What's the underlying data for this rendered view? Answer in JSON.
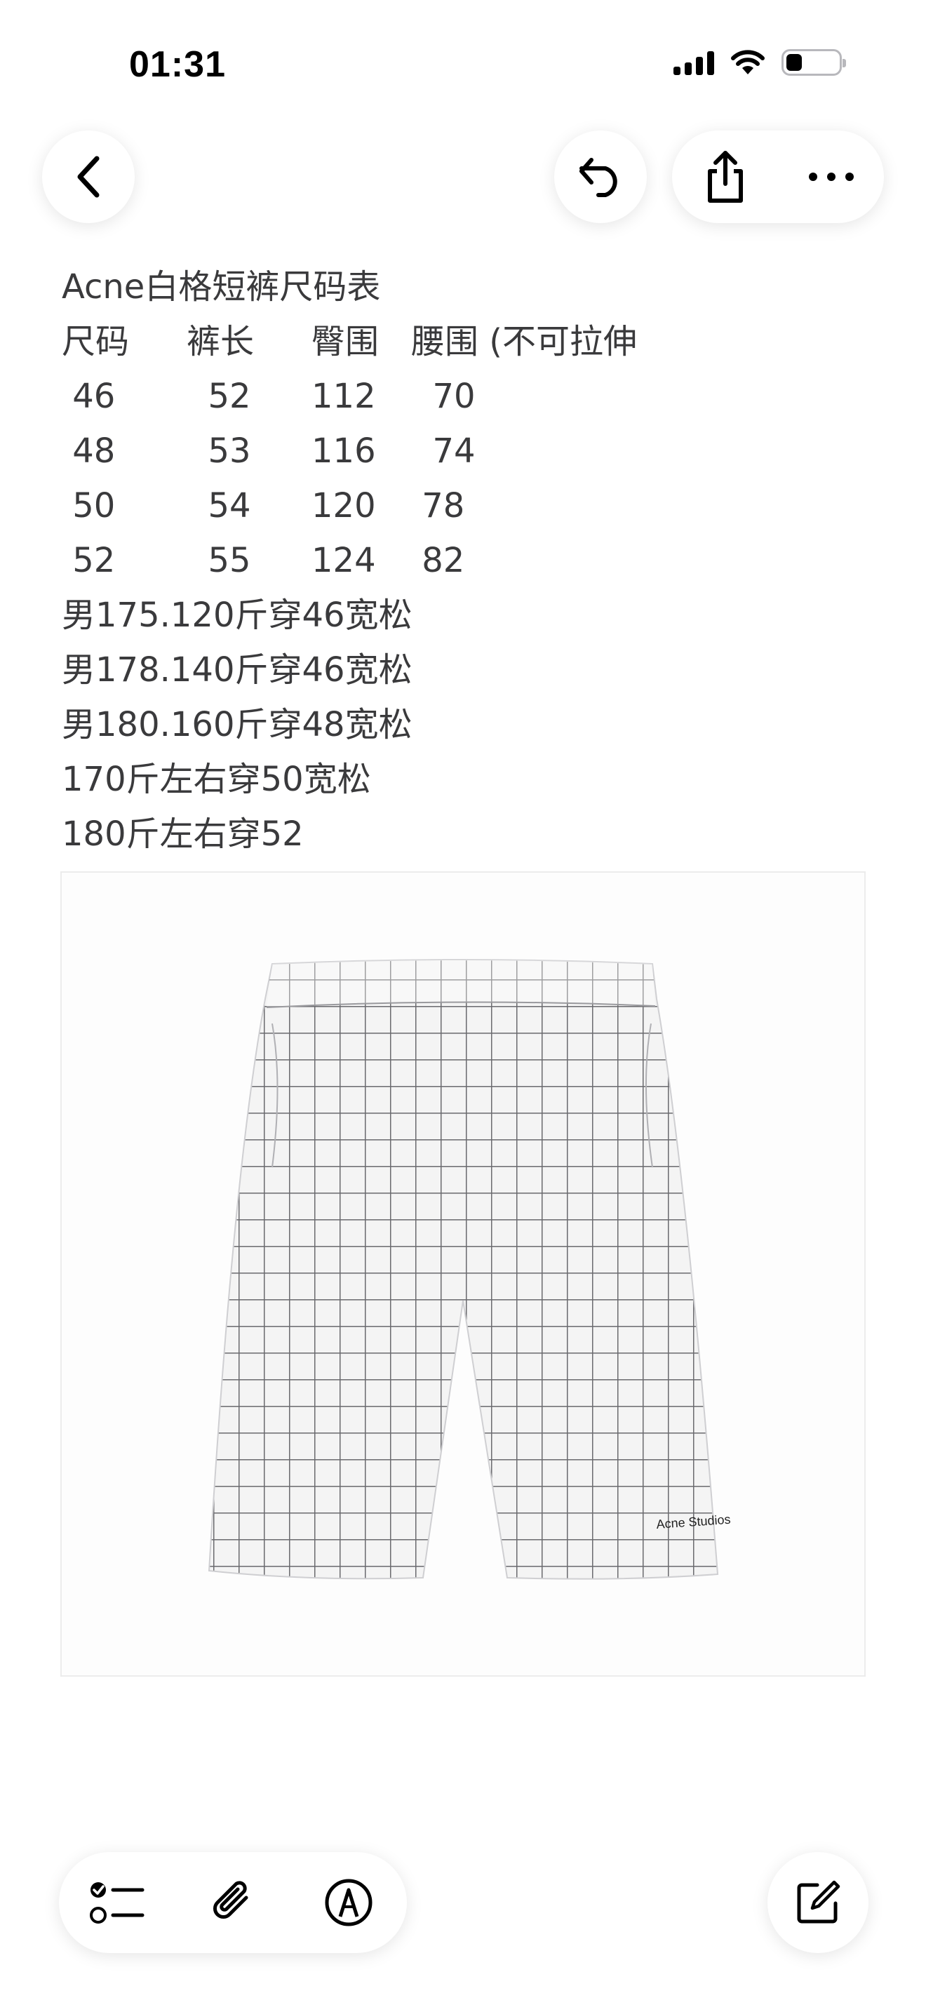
{
  "status_bar": {
    "time": "01:31",
    "battery_level": 0.3
  },
  "toolbar": {
    "back_icon": "chevron-left-icon",
    "undo_icon": "undo-icon",
    "share_icon": "share-icon",
    "more_icon": "ellipsis-icon"
  },
  "note": {
    "title": "Acne白格短裤尺码表",
    "table_header": [
      "尺码",
      "裤长",
      "臀围",
      "腰围 (不可拉伸"
    ],
    "table_rows": [
      [
        " 46",
        "  52",
        "112",
        "  70"
      ],
      [
        " 48",
        "  53",
        "116",
        "  74"
      ],
      [
        " 50",
        "  54",
        "120",
        " 78"
      ],
      [
        " 52",
        "  55",
        "124",
        " 82"
      ]
    ],
    "recommendations": [
      "男175.120斤穿46宽松",
      "男178.140斤穿46宽松",
      "男180.160斤穿48宽松",
      "170斤左右穿50宽松",
      "180斤左右穿52"
    ],
    "photo_brand_text": "Acne Studios"
  },
  "bottom_toolbar": {
    "checklist_icon": "checklist-icon",
    "attach_icon": "paperclip-icon",
    "markup_icon": "pen-markup-icon",
    "compose_icon": "compose-icon"
  }
}
